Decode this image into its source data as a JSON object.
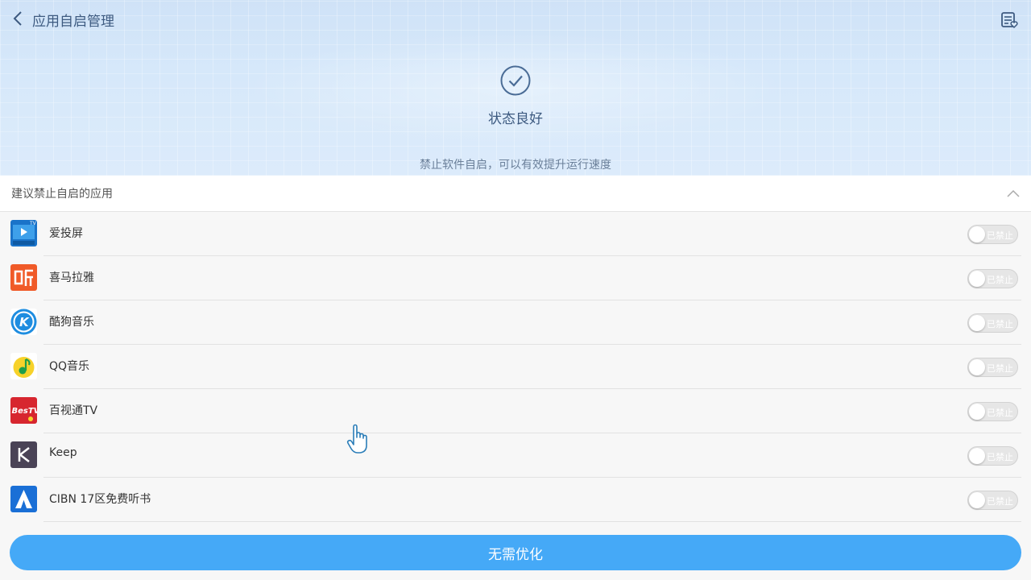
{
  "header": {
    "title": "应用自启管理",
    "status": "状态良好",
    "subtitle": "禁止软件自启，可以有效提升运行速度"
  },
  "section": {
    "title": "建议禁止自启的应用"
  },
  "apps": [
    {
      "name": "爱投屏",
      "toggle_label": "已禁止",
      "enabled": false,
      "icon": "screen-cast-icon",
      "color": "#1a73c9"
    },
    {
      "name": "喜马拉雅",
      "toggle_label": "已禁止",
      "enabled": false,
      "icon": "ximalaya-icon",
      "color": "#f05a28"
    },
    {
      "name": "酷狗音乐",
      "toggle_label": "已禁止",
      "enabled": false,
      "icon": "kugou-icon",
      "color": "#1e8de0"
    },
    {
      "name": "QQ音乐",
      "toggle_label": "已禁止",
      "enabled": false,
      "icon": "qq-music-icon",
      "color": "#f7d22a"
    },
    {
      "name": "百视通TV",
      "toggle_label": "已禁止",
      "enabled": false,
      "icon": "bestv-icon",
      "color": "#d7262f"
    },
    {
      "name": "Keep",
      "toggle_label": "已禁止",
      "enabled": false,
      "icon": "keep-icon",
      "color": "#4a4356"
    },
    {
      "name": "CIBN 17区免费听书",
      "toggle_label": "已禁止",
      "enabled": false,
      "icon": "cibn-icon",
      "color": "#1a6fd6"
    }
  ],
  "footer": {
    "button_label": "无需优化"
  },
  "colors": {
    "accent": "#45a9f7",
    "title_text": "#3d5a80"
  }
}
